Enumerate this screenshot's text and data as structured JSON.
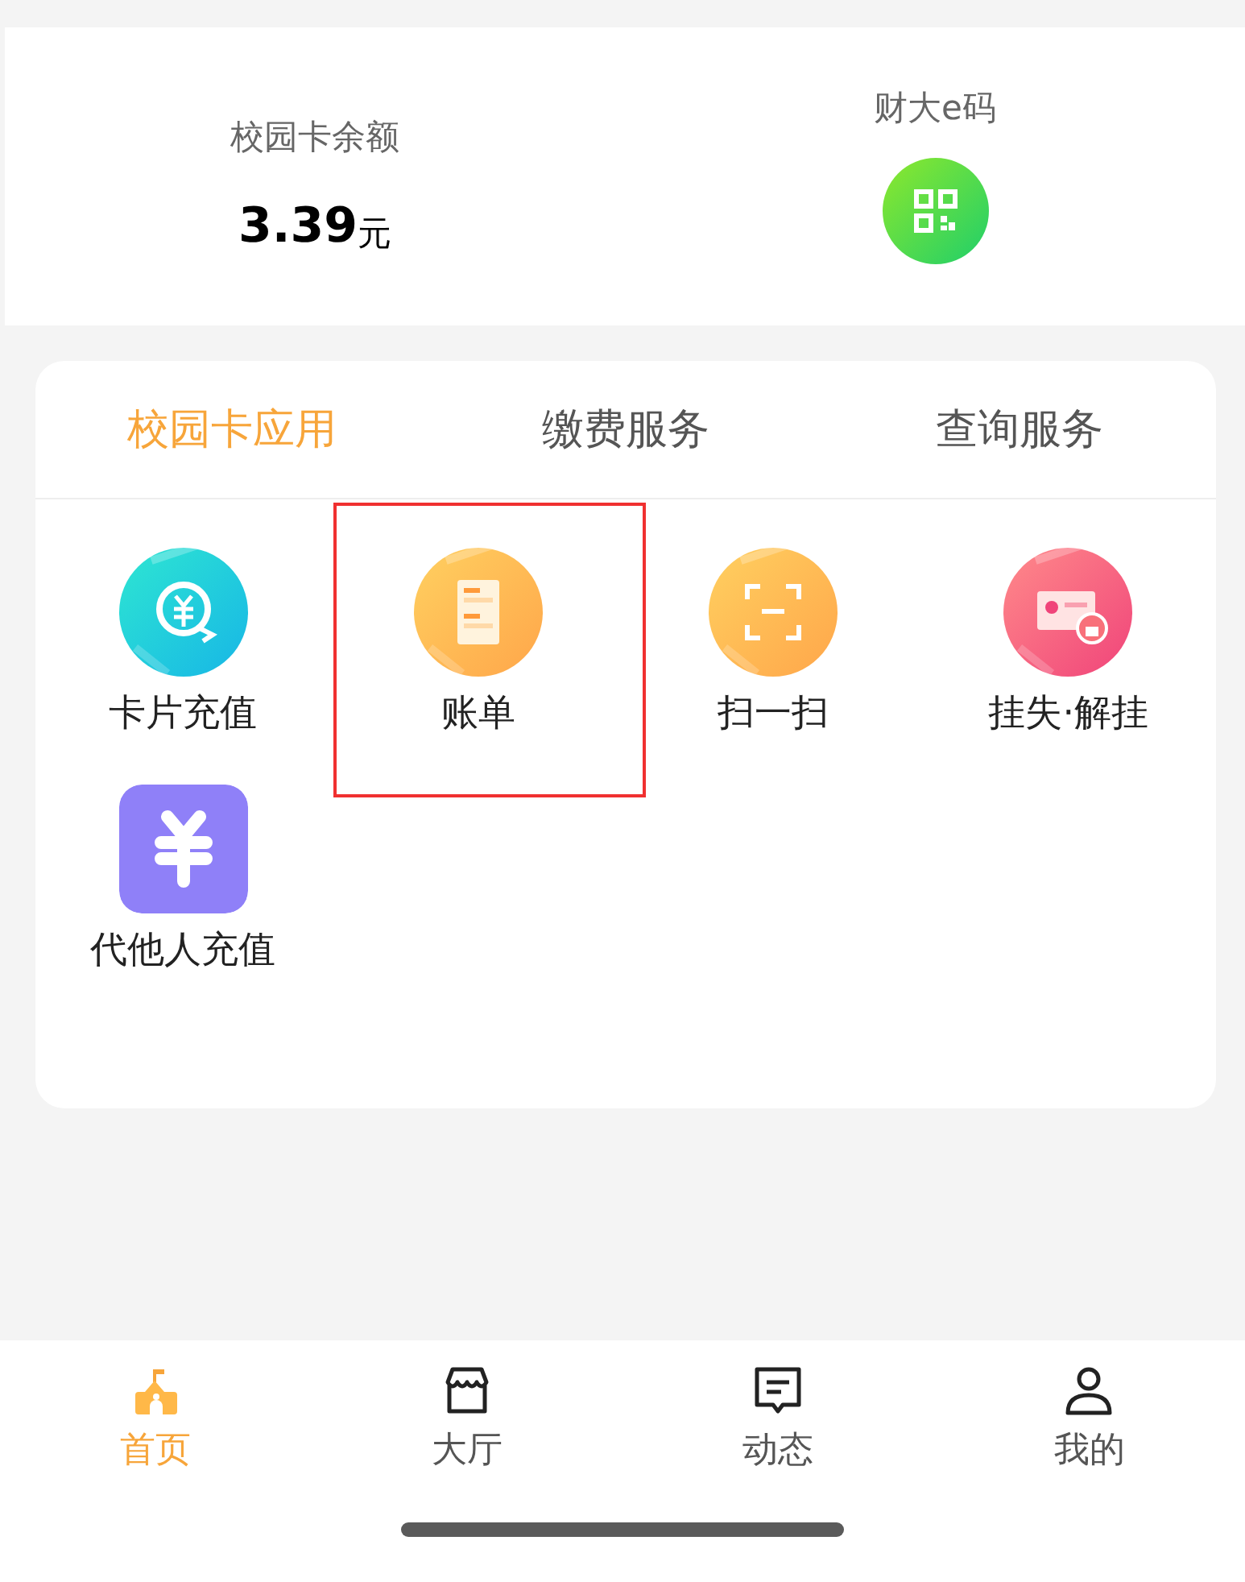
{
  "summary": {
    "balance_label": "校园卡余额",
    "balance_amount": "3.39",
    "balance_unit": "元",
    "code_label": "财大e码"
  },
  "tabs": [
    {
      "label": "校园卡应用",
      "selected": true
    },
    {
      "label": "缴费服务",
      "selected": false
    },
    {
      "label": "查询服务",
      "selected": false
    }
  ],
  "apps": [
    {
      "label": "卡片充值",
      "kind": "recharge",
      "highlighted": false
    },
    {
      "label": "账单",
      "kind": "bill",
      "highlighted": true
    },
    {
      "label": "扫一扫",
      "kind": "scan",
      "highlighted": false
    },
    {
      "label": "挂失·解挂",
      "kind": "lost",
      "highlighted": false
    },
    {
      "label": "代他人充值",
      "kind": "proxy",
      "highlighted": false
    }
  ],
  "bottom_nav": [
    {
      "label": "首页",
      "kind": "home",
      "selected": true
    },
    {
      "label": "大厅",
      "kind": "hall",
      "selected": false
    },
    {
      "label": "动态",
      "kind": "news",
      "selected": false
    },
    {
      "label": "我的",
      "kind": "me",
      "selected": false
    }
  ]
}
